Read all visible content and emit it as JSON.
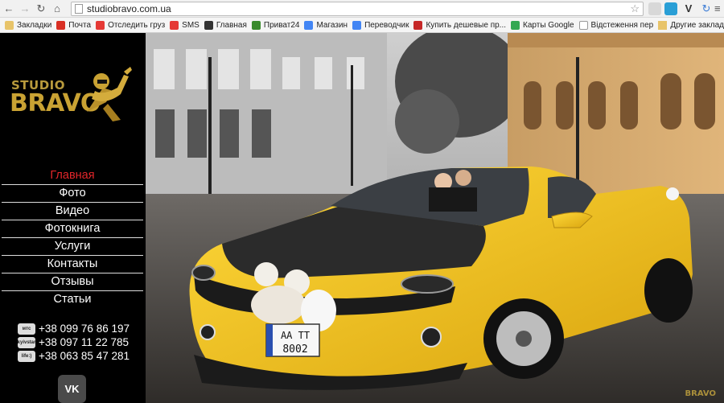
{
  "browser": {
    "url": "studiobravo.com.ua",
    "bookmarks": [
      {
        "label": "Закладки",
        "icon": "folder-icon",
        "color": "#e8c46a"
      },
      {
        "label": "Почта",
        "icon": "gmail-icon",
        "color": "#d93025"
      },
      {
        "label": "Отследить груз",
        "icon": "cargo-icon",
        "color": "#e53935"
      },
      {
        "label": "SMS",
        "icon": "sms-icon",
        "color": "#e53935"
      },
      {
        "label": "Главная",
        "icon": "home-site-icon",
        "color": "#333333"
      },
      {
        "label": "Приват24",
        "icon": "privat-icon",
        "color": "#3a8b2d"
      },
      {
        "label": "Магазин",
        "icon": "store-icon",
        "color": "#4285f4"
      },
      {
        "label": "Переводчик",
        "icon": "translate-icon",
        "color": "#4285f4"
      },
      {
        "label": "Купить дешевые пр...",
        "icon": "buy-icon",
        "color": "#c62828"
      },
      {
        "label": "Карты Google",
        "icon": "maps-icon",
        "color": "#34a853"
      },
      {
        "label": "Відстеження перес...",
        "icon": "page-icon",
        "color": "#ffffff"
      }
    ],
    "other_bookmarks": "Другие заклад"
  },
  "site": {
    "logo": {
      "line1": "STUDIO",
      "line2": "BRAVO"
    },
    "menu": [
      {
        "label": "Главная",
        "active": true
      },
      {
        "label": "Фото",
        "active": false
      },
      {
        "label": "Видео",
        "active": false
      },
      {
        "label": "Фотокнига",
        "active": false
      },
      {
        "label": "Услуги",
        "active": false
      },
      {
        "label": "Контакты",
        "active": false
      },
      {
        "label": "Отзывы",
        "active": false
      },
      {
        "label": "Статьи",
        "active": false
      }
    ],
    "phones": [
      {
        "operator": "мтс",
        "number": "+38 099 76 86 197"
      },
      {
        "operator": "kyivstar",
        "number": "+38 097 11 22 785"
      },
      {
        "operator": "life:)",
        "number": "+38 063 85 47 281"
      }
    ],
    "social": {
      "vk_label": "VK"
    },
    "hero": {
      "plate_line1": "АА ТТ",
      "plate_line2": "8002",
      "watermark": "BRAVO"
    },
    "colors": {
      "accent": "#e3262a",
      "logo_gold": "#c9a233",
      "car_yellow": "#f2c417"
    }
  }
}
